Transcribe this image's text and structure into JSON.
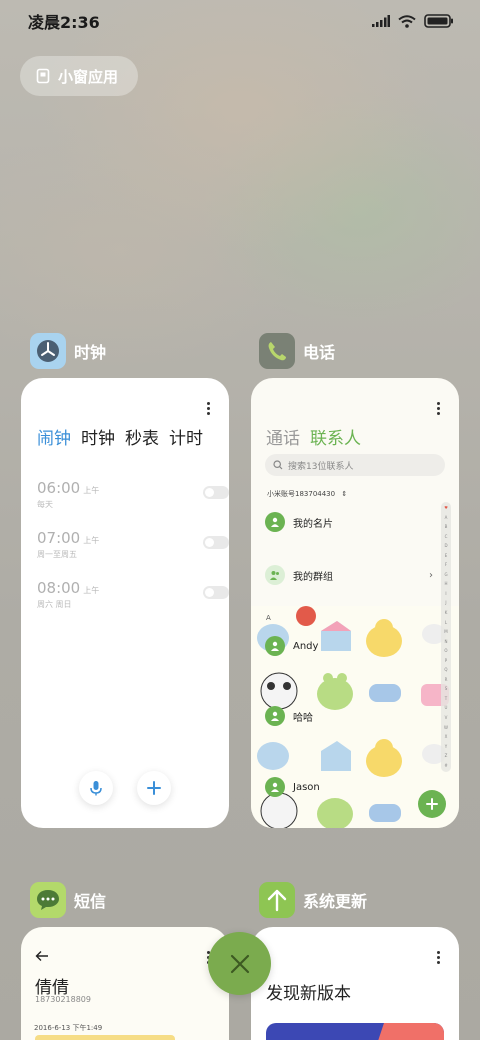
{
  "status_bar": {
    "time": "凌晨2:36"
  },
  "small_window": {
    "label": "小窗应用"
  },
  "apps": {
    "clock": {
      "title": "时钟",
      "tabs": [
        "闹钟",
        "时钟",
        "秒表",
        "计时"
      ],
      "active_tab": "闹钟",
      "alarms": [
        {
          "time": "06:00",
          "ampm": "上午",
          "repeat": "每天",
          "enabled": false
        },
        {
          "time": "07:00",
          "ampm": "上午",
          "repeat": "周一至周五",
          "enabled": false
        },
        {
          "time": "08:00",
          "ampm": "上午",
          "repeat": "周六 周日",
          "enabled": false
        }
      ]
    },
    "phone": {
      "title": "电话",
      "tabs": [
        "通话",
        "联系人"
      ],
      "active_tab": "联系人",
      "search_placeholder": "搜索13位联系人",
      "account": "小米账号183704430",
      "my_card": "我的名片",
      "my_groups": "我的群组",
      "section_letter": "A",
      "contacts": [
        "Andy",
        "哈哈",
        "Jason"
      ],
      "index_letters": [
        "♥",
        "A",
        "B",
        "C",
        "D",
        "E",
        "F",
        "G",
        "H",
        "I",
        "J",
        "K",
        "L",
        "M",
        "N",
        "O",
        "P",
        "Q",
        "R",
        "S",
        "T",
        "U",
        "V",
        "W",
        "X",
        "Y",
        "Z",
        "#"
      ]
    },
    "sms": {
      "title": "短信",
      "contact_name": "倩倩",
      "contact_number": "18730218809",
      "date": "2016-6-13 下午1:49"
    },
    "update": {
      "title": "系统更新",
      "headline": "发现新版本"
    }
  },
  "colors": {
    "accent_green": "#6bb352",
    "accent_blue": "#3a8fd8",
    "close_button": "#7bab4e"
  }
}
